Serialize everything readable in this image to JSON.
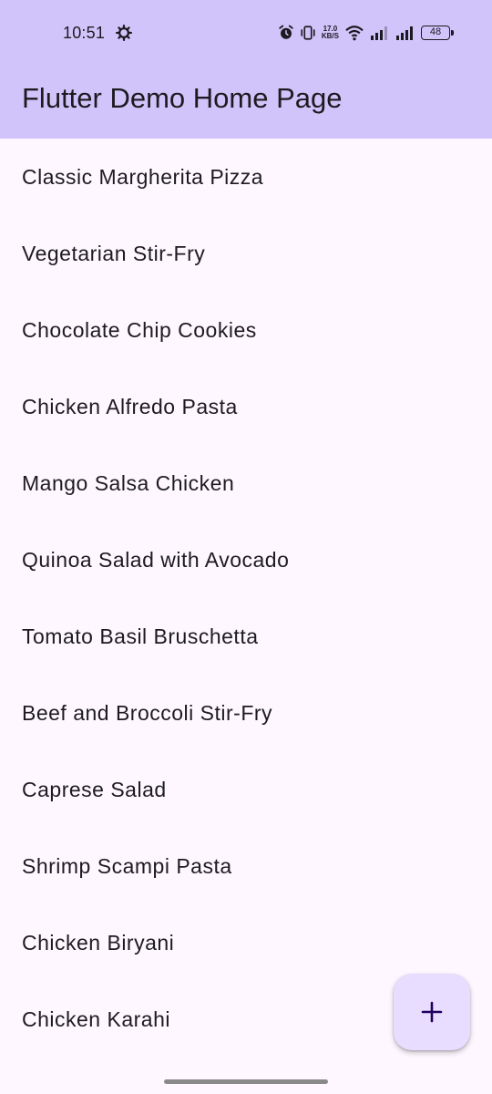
{
  "status_bar": {
    "time": "10:51",
    "net_speed_value": "17.0",
    "net_speed_unit": "KB/S",
    "battery": "48"
  },
  "app_bar": {
    "title": "Flutter Demo Home Page"
  },
  "recipes": [
    "Classic Margherita Pizza",
    "Vegetarian Stir-Fry",
    "Chocolate Chip Cookies",
    "Chicken Alfredo Pasta",
    "Mango Salsa Chicken",
    "Quinoa Salad with Avocado",
    "Tomato Basil Bruschetta",
    "Beef and Broccoli Stir-Fry",
    "Caprese Salad",
    "Shrimp Scampi Pasta",
    "Chicken Biryani",
    "Chicken Karahi"
  ],
  "fab": {
    "icon": "plus-icon"
  },
  "colors": {
    "app_bar": "#d1c4fb",
    "background": "#fef7ff",
    "fab": "#e9ddff",
    "text": "#1d1b20"
  }
}
